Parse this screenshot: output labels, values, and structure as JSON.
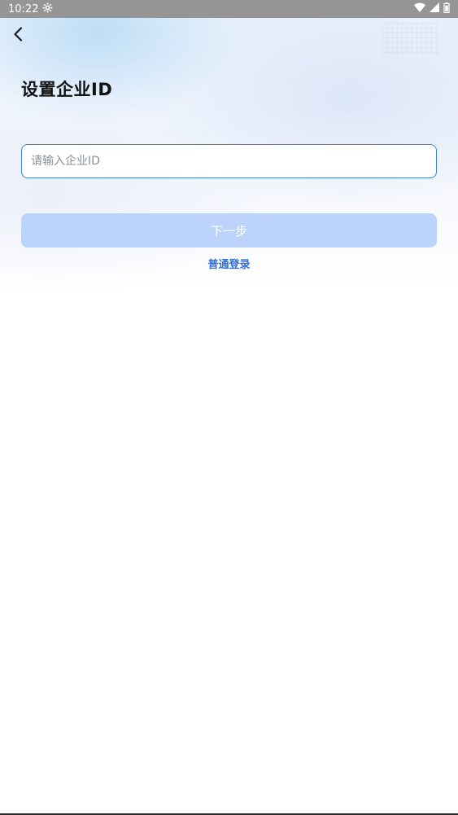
{
  "status_bar": {
    "time": "10:22",
    "icons": [
      "settings-gear-icon",
      "wifi-icon",
      "cell-signal-icon",
      "battery-icon"
    ]
  },
  "header": {
    "back_icon": "chevron-left-icon",
    "title": "设置企业ID"
  },
  "form": {
    "enterprise_id_value": "",
    "enterprise_id_placeholder": "请输入企业ID",
    "next_label": "下一步",
    "normal_login_label": "普通登录"
  },
  "colors": {
    "accent": "#3d7fe5",
    "button_disabled": "#bcd3fb",
    "link": "#2f6fdb",
    "status_bar": "#959595"
  }
}
